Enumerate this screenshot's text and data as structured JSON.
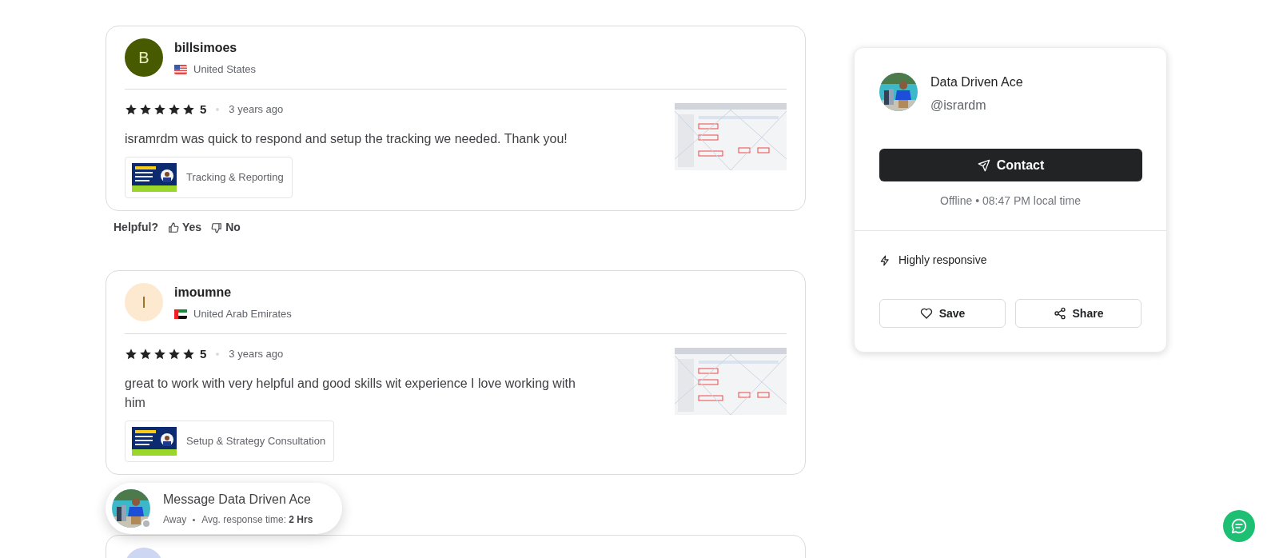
{
  "reviews": [
    {
      "user": "billsimoes",
      "avatar_letter": "B",
      "color": "#475a00",
      "country": "United States",
      "stars": 5,
      "rating": "5",
      "time": "3 years ago",
      "text": "isramrdm was quick to respond and setup the tracking we needed. Thank you!",
      "gig": "Tracking & Reporting",
      "helpful": {
        "label": "Helpful?",
        "yes": "Yes",
        "no": "No"
      }
    },
    {
      "user": "imoumne",
      "avatar_letter": "I",
      "color": "#fde9cf",
      "country": "United Arab Emirates",
      "stars": 5,
      "rating": "5",
      "time": "3 years ago",
      "text": "great to work with very helpful and good skills wit experience I love working with him",
      "gig": "Setup & Strategy Consultation"
    },
    {
      "color": "#cdd6f2"
    }
  ],
  "message_bubble": {
    "title": "Message Data Driven Ace",
    "status": "Away",
    "response_label": "Avg. response time:",
    "response_value": "2 Hrs",
    "online": false
  },
  "seller": {
    "name": "Data Driven Ace",
    "handle": "@isrardm",
    "contact": "Contact",
    "availability": "Offline • 08:47 PM local time",
    "badge": "Highly responsive",
    "save": "Save",
    "share": "Share"
  }
}
